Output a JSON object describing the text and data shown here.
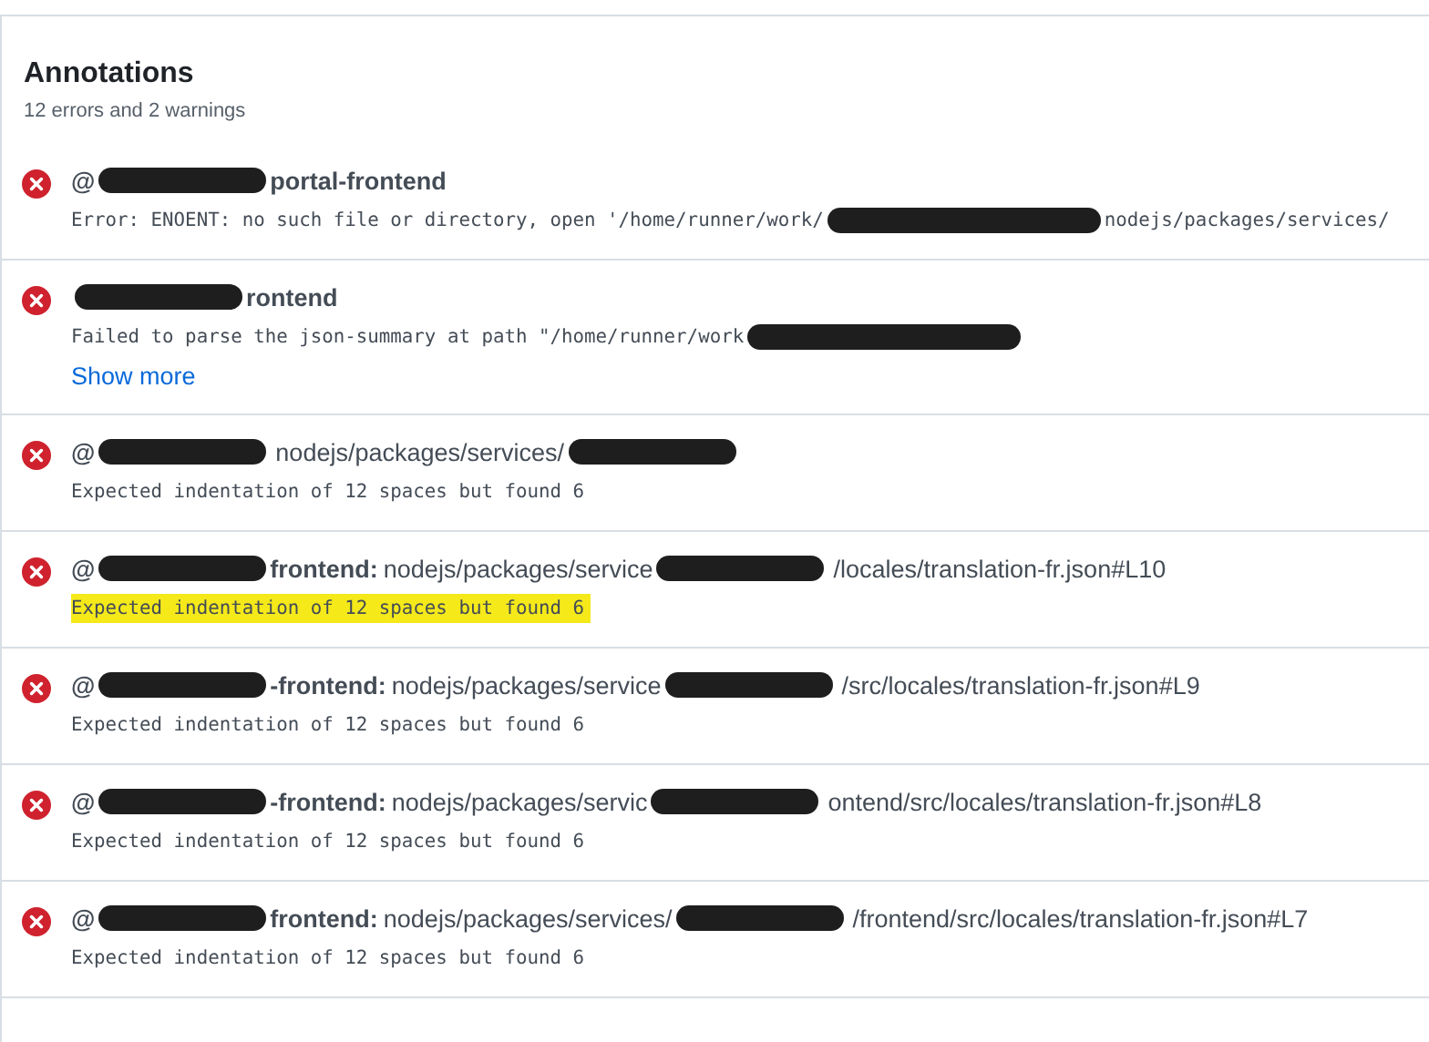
{
  "header": {
    "title": "Annotations",
    "summary": "12 errors and 2 warnings"
  },
  "annotations": [
    {
      "kind": "error",
      "title": [
        {
          "kind": "bold",
          "text": "@"
        },
        {
          "kind": "redacted"
        },
        {
          "kind": "bold",
          "text": "portal-frontend"
        }
      ],
      "message": [
        {
          "kind": "text",
          "text": "Error: ENOENT: no such file or directory, open '/home/runner/work/"
        },
        {
          "kind": "redacted"
        },
        {
          "kind": "text",
          "text": "nodejs/packages/services/"
        }
      ],
      "highlighted": false
    },
    {
      "kind": "error",
      "title": [
        {
          "kind": "redacted"
        },
        {
          "kind": "bold",
          "text": "rontend"
        }
      ],
      "message": [
        {
          "kind": "text",
          "text": "Failed to parse the json-summary at path \"/home/runner/work"
        },
        {
          "kind": "redacted"
        }
      ],
      "highlighted": false,
      "link": "Show more"
    },
    {
      "kind": "error",
      "title": [
        {
          "kind": "bold",
          "text": "@"
        },
        {
          "kind": "redacted"
        },
        {
          "kind": "normal",
          "text": "nodejs/packages/services/"
        },
        {
          "kind": "redacted"
        }
      ],
      "message": [
        {
          "kind": "text",
          "text": "Expected indentation of 12 spaces but found 6"
        }
      ],
      "highlighted": false
    },
    {
      "kind": "error",
      "title": [
        {
          "kind": "bold",
          "text": "@"
        },
        {
          "kind": "redacted"
        },
        {
          "kind": "bold",
          "text": "frontend:"
        },
        {
          "kind": "normal",
          "text": "nodejs/packages/service"
        },
        {
          "kind": "redacted"
        },
        {
          "kind": "normal",
          "text": "/locales/translation-fr.json#L10"
        }
      ],
      "message": [
        {
          "kind": "text",
          "text": "Expected indentation of 12 spaces but found 6"
        }
      ],
      "highlighted": true
    },
    {
      "kind": "error",
      "title": [
        {
          "kind": "bold",
          "text": "@"
        },
        {
          "kind": "redacted"
        },
        {
          "kind": "bold",
          "text": "-frontend:"
        },
        {
          "kind": "normal",
          "text": "nodejs/packages/service"
        },
        {
          "kind": "redacted"
        },
        {
          "kind": "normal",
          "text": "/src/locales/translation-fr.json#L9"
        }
      ],
      "message": [
        {
          "kind": "text",
          "text": "Expected indentation of 12 spaces but found 6"
        }
      ],
      "highlighted": false
    },
    {
      "kind": "error",
      "title": [
        {
          "kind": "bold",
          "text": "@"
        },
        {
          "kind": "redacted"
        },
        {
          "kind": "bold",
          "text": "-frontend:"
        },
        {
          "kind": "normal",
          "text": "nodejs/packages/servic"
        },
        {
          "kind": "redacted"
        },
        {
          "kind": "normal",
          "text": "ontend/src/locales/translation-fr.json#L8"
        }
      ],
      "message": [
        {
          "kind": "text",
          "text": "Expected indentation of 12 spaces but found 6"
        }
      ],
      "highlighted": false
    },
    {
      "kind": "error",
      "title": [
        {
          "kind": "bold",
          "text": "@"
        },
        {
          "kind": "redacted"
        },
        {
          "kind": "bold",
          "text": "frontend:"
        },
        {
          "kind": "normal",
          "text": "nodejs/packages/services/"
        },
        {
          "kind": "redacted"
        },
        {
          "kind": "normal",
          "text": "/frontend/src/locales/translation-fr.json#L7"
        }
      ],
      "message": [
        {
          "kind": "text",
          "text": "Expected indentation of 12 spaces but found 6"
        }
      ],
      "highlighted": false
    }
  ]
}
